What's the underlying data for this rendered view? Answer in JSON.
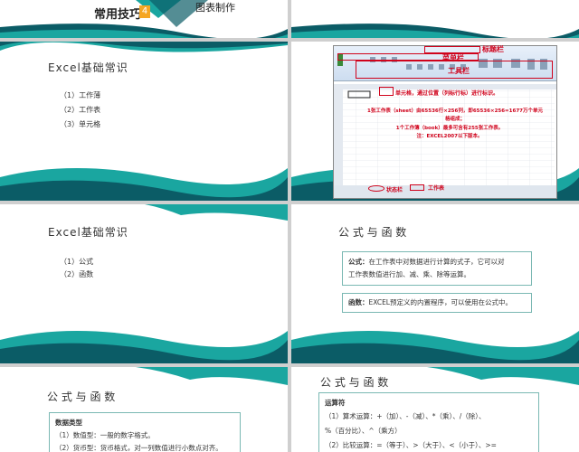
{
  "slide1": {
    "title": "常用技巧",
    "badge": "4",
    "subtitle": "图表制作"
  },
  "slide3": {
    "title": "Excel基础常识",
    "items": [
      "（1）工作薄",
      "（2）工作表",
      "（3）单元格"
    ]
  },
  "slide5": {
    "title": "Excel基础常识",
    "items": [
      "（1）公式",
      "（2）函数"
    ]
  },
  "slide6": {
    "title": "公 式 与 函 数",
    "box1_label": "公式：",
    "box1_line1": "在工作表中对数据进行计算的式子，它可以对",
    "box1_line2": "工作表数值进行加、减、乘、除等运算。",
    "box2_label": "函数：",
    "box2_text": "EXCEL预定义的内置程序，可以使用在公式中。"
  },
  "slide7": {
    "title": "公 式 与 函 数",
    "heading": "数据类型",
    "lines": [
      "（1）数值型：一般的数字格式。",
      "（2）货币型：货币格式，对一列数值进行小数点对齐。"
    ]
  },
  "slide8": {
    "title": "公 式 与 函 数",
    "heading": "运算符",
    "lines": [
      "（1）算术运算：+（加）、-（减）、*（乘）、/（除）、",
      "%（百分比）、^（乘方）",
      "（2）比较运算：=（等于）、>（大于）、<（小于）、>="
    ]
  },
  "excel": {
    "label_title": "标题栏",
    "label_menu": "菜单栏",
    "label_tools": "工具栏",
    "label_cell": "单元格，通过位置（列标行标）进行标识。",
    "label_sheet_info": "1张工作表（sheet）由65536行×256列，即65536×256=1677万个单元格组成；",
    "label_book_info": "1个工作簿（book）最多可含有255张工作表。",
    "label_note": "注：EXCEL2007以下版本。",
    "label_status": "状态栏",
    "label_sheet": "工作表"
  },
  "colors": {
    "teal": "#1aa6a0",
    "dark": "#0b5c66",
    "badge": "#f5a623",
    "red": "#d0021b"
  }
}
